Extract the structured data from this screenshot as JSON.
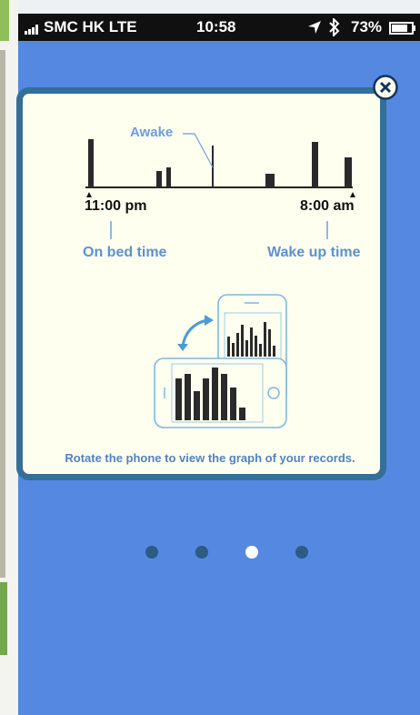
{
  "status_bar": {
    "carrier": "SMC HK  LTE",
    "time": "10:58",
    "battery": "73%"
  },
  "tutorial": {
    "awake_label": "Awake",
    "bed_time": "11:00 pm",
    "wake_time": "8:00 am",
    "on_bed_label": "On bed time",
    "wake_up_label": "Wake up time",
    "instruction": "Rotate the phone to view the graph of your records."
  },
  "pager": {
    "count": 4,
    "active_index": 2
  },
  "colors": {
    "background": "#5588e0",
    "card": "#fffff0",
    "card_border": "#336f96",
    "accent": "#5a90d8"
  },
  "icons": [
    "signal-icon",
    "location-arrow-icon",
    "bluetooth-icon",
    "battery-icon",
    "close-icon",
    "rotate-arrow-icon"
  ]
}
